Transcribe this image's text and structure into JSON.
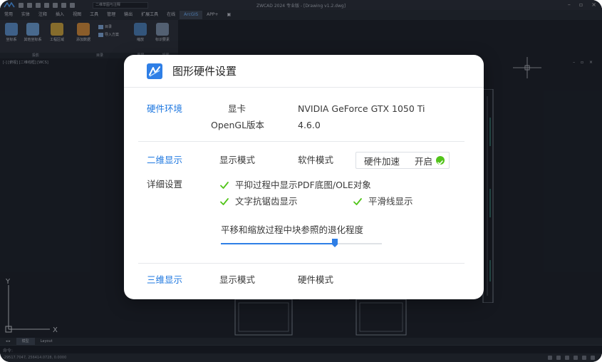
{
  "app": {
    "title": "ZWCAD 2024 专业版 - [Drawing v1.2.dwg]",
    "workspace": "二维草图与注释",
    "menus": [
      "常用",
      "实体",
      "注释",
      "插入",
      "视图",
      "工具",
      "管理",
      "输出",
      "扩展工具",
      "在线",
      "ArcGIS",
      "APP+"
    ],
    "active_menu": "ArcGIS",
    "ribbon_buttons": [
      "坐标系",
      "其他坐标系",
      "工程区域",
      "添加数据",
      "缩放",
      "标识要素"
    ],
    "ribbon_small": [
      "目录",
      "导入方案"
    ],
    "ribbon_groups": [
      "投影",
      "目录",
      "图层",
      "视图"
    ],
    "viewport_label": "[-] [俯视] [二维线框] [WCS]",
    "viewport_controls": "– ▫ ×",
    "layout_tabs": [
      "模型",
      "Layout"
    ],
    "command_prompt": "命令:",
    "status_coords": "-29517.7047, 256414.0728, 0.0000",
    "axis_x": "X",
    "axis_y": "Y"
  },
  "dialog": {
    "title": "图形硬件设置",
    "hardware": {
      "section": "硬件环境",
      "gpu_label": "显卡",
      "gpu_value": "NVIDIA GeForce GTX  1050  Ti",
      "opengl_label": "OpenGL版本",
      "opengl_value": "4.6.0"
    },
    "two_d": {
      "section": "二维显示",
      "mode_label": "显示模式",
      "mode_value": "软件模式",
      "accel_label": "硬件加速",
      "accel_state": "开启",
      "detail_label": "详细设置",
      "options": [
        {
          "label": "平抑过程中显示PDF底图/OLE对象",
          "checked": true
        },
        {
          "label": "文字抗锯齿显示",
          "checked": true
        },
        {
          "label": "平滑线显示",
          "checked": true
        }
      ],
      "degradation_label": "平移和缩放过程中块参照的退化程度",
      "degradation_level": 0.71
    },
    "three_d": {
      "section": "三维显示",
      "mode_label": "显示模式",
      "mode_value": "硬件模式"
    }
  },
  "colors": {
    "accent": "#1f78e0",
    "slider": "#2f7fe6",
    "success": "#52c41a",
    "check": "#52c41a"
  }
}
